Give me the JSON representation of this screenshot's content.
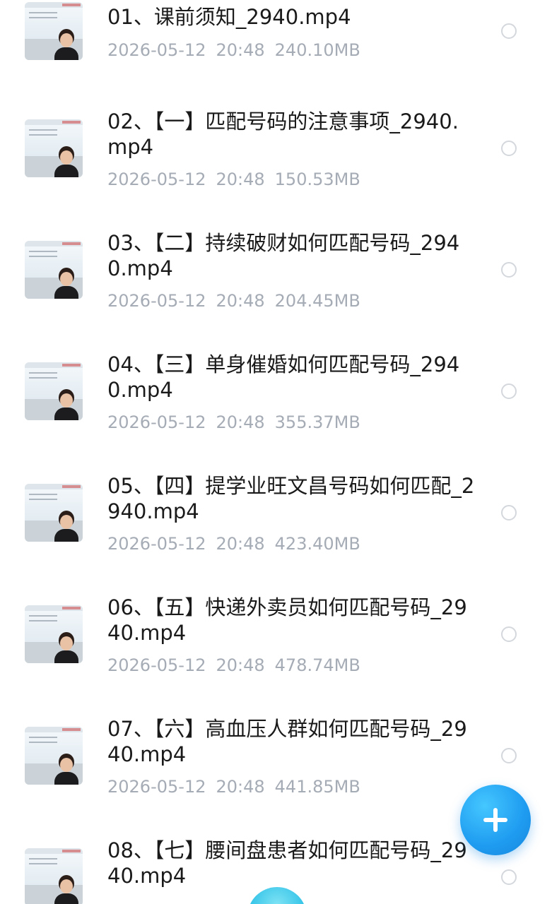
{
  "files": [
    {
      "name": "01、课前须知_2940.mp4",
      "date": "2026-05-12",
      "time": "20:48",
      "size": "240.10MB"
    },
    {
      "name": "02、【一】匹配号码的注意事项_2940.mp4",
      "date": "2026-05-12",
      "time": "20:48",
      "size": "150.53MB"
    },
    {
      "name": "03、【二】持续破财如何匹配号码_2940.mp4",
      "date": "2026-05-12",
      "time": "20:48",
      "size": "204.45MB"
    },
    {
      "name": "04、【三】单身催婚如何匹配号码_2940.mp4",
      "date": "2026-05-12",
      "time": "20:48",
      "size": "355.37MB"
    },
    {
      "name": "05、【四】提学业旺文昌号码如何匹配_2940.mp4",
      "date": "2026-05-12",
      "time": "20:48",
      "size": "423.40MB"
    },
    {
      "name": "06、【五】快递外卖员如何匹配号码_2940.mp4",
      "date": "2026-05-12",
      "time": "20:48",
      "size": "478.74MB"
    },
    {
      "name": "07、【六】高血压人群如何匹配号码_2940.mp4",
      "date": "2026-05-12",
      "time": "20:48",
      "size": "441.85MB"
    },
    {
      "name": "08、【七】腰间盘患者如何匹配号码_2940.mp4",
      "date": "",
      "time": "",
      "size": ""
    }
  ],
  "fab": {
    "icon": "plus-icon",
    "color": "#1e9bf0"
  }
}
